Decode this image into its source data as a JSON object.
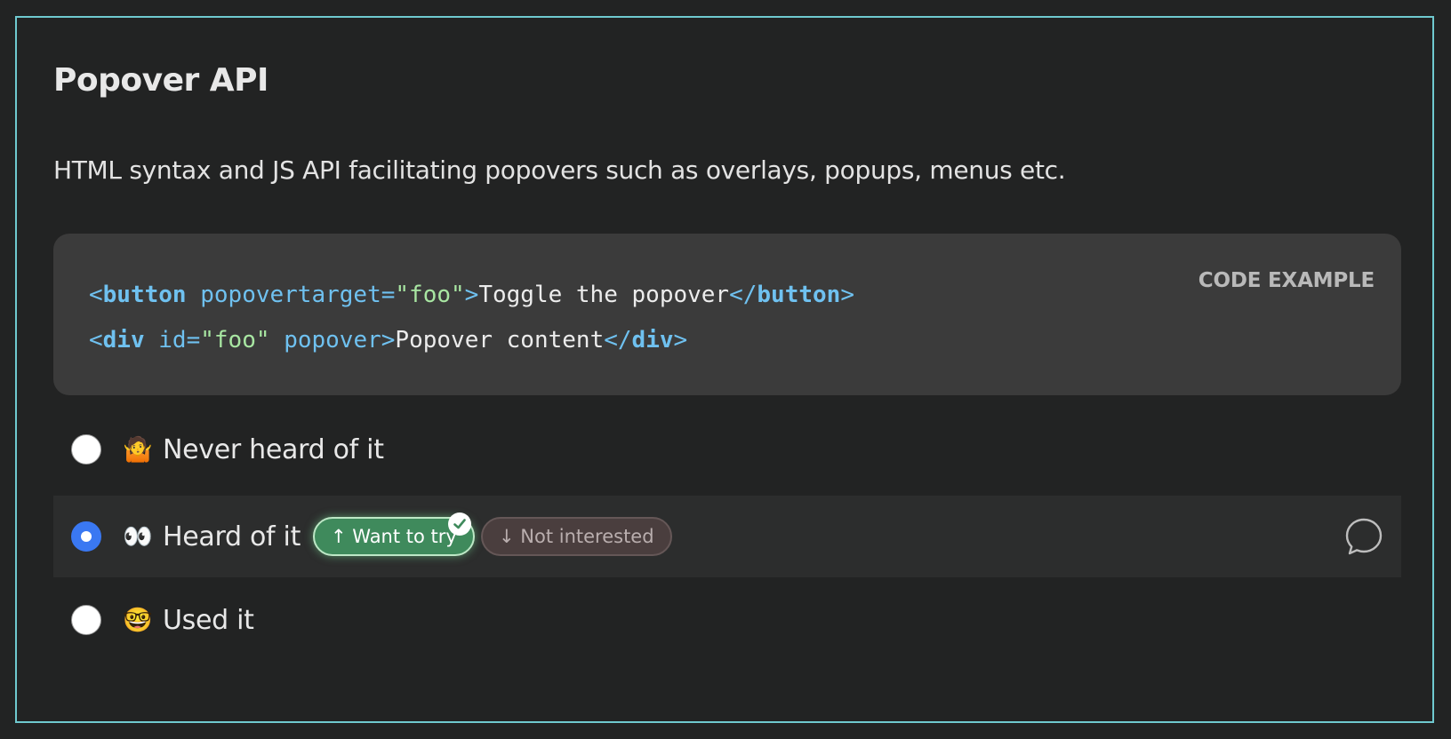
{
  "card": {
    "title": "Popover API",
    "description": "HTML syntax and JS API facilitating popovers such as overlays, popups, menus etc."
  },
  "code_example": {
    "label": "CODE EXAMPLE",
    "lines": [
      [
        {
          "t": "<",
          "c": "punct"
        },
        {
          "t": "button",
          "c": "tag"
        },
        {
          "t": " ",
          "c": "text"
        },
        {
          "t": "popovertarget",
          "c": "attr"
        },
        {
          "t": "=",
          "c": "punct"
        },
        {
          "t": "\"foo\"",
          "c": "str"
        },
        {
          "t": ">",
          "c": "punct"
        },
        {
          "t": "Toggle the popover",
          "c": "text"
        },
        {
          "t": "</",
          "c": "punct"
        },
        {
          "t": "button",
          "c": "tag"
        },
        {
          "t": ">",
          "c": "punct"
        }
      ],
      [
        {
          "t": "<",
          "c": "punct"
        },
        {
          "t": "div",
          "c": "tag"
        },
        {
          "t": " ",
          "c": "text"
        },
        {
          "t": "id",
          "c": "attr"
        },
        {
          "t": "=",
          "c": "punct"
        },
        {
          "t": "\"foo\"",
          "c": "str"
        },
        {
          "t": " ",
          "c": "text"
        },
        {
          "t": "popover",
          "c": "attr"
        },
        {
          "t": ">",
          "c": "punct"
        },
        {
          "t": "Popover content",
          "c": "text"
        },
        {
          "t": "</",
          "c": "punct"
        },
        {
          "t": "div",
          "c": "tag"
        },
        {
          "t": ">",
          "c": "punct"
        }
      ]
    ]
  },
  "options": [
    {
      "emoji": "🤷",
      "label": "Never heard of it",
      "selected": false
    },
    {
      "emoji": "👀",
      "label": "Heard of it",
      "selected": true
    },
    {
      "emoji": "🤓",
      "label": "Used it",
      "selected": false
    }
  ],
  "sentiment": {
    "want_to_try": "↑ Want to try",
    "not_interested": "↓ Not interested",
    "selected": "want_to_try"
  },
  "colors": {
    "frame": "#6fc9cf",
    "accent_radio": "#3a78f2",
    "want_to_try_bg": "#3f8a5c",
    "code_keyword": "#6fc1f0",
    "code_string": "#a8e6a2"
  },
  "icons": {
    "check": "check-icon",
    "comment": "comment-bubble-icon"
  }
}
